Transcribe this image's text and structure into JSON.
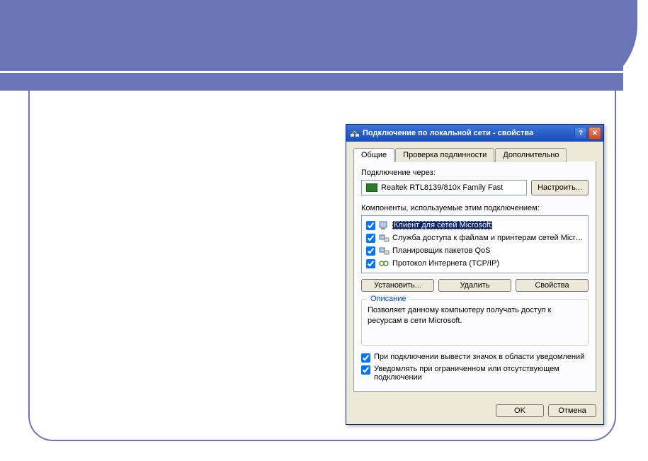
{
  "window": {
    "title": "Подключение по локальной сети - свойства",
    "help_label": "?",
    "close_label": "✕"
  },
  "tabs": [
    {
      "label": "Общие",
      "active": true
    },
    {
      "label": "Проверка подлинности",
      "active": false
    },
    {
      "label": "Дополнительно",
      "active": false
    }
  ],
  "connect_via": {
    "label": "Подключение через:",
    "adapter": "Realtek RTL8139/810x Family Fast",
    "configure_btn": "Настроить..."
  },
  "components": {
    "label": "Компоненты, используемые этим подключением:",
    "items": [
      {
        "checked": true,
        "icon": "client-icon",
        "label": "Клиент для сетей Microsoft",
        "selected": true
      },
      {
        "checked": true,
        "icon": "service-icon",
        "label": "Служба доступа к файлам и принтерам сетей Micro..."
      },
      {
        "checked": true,
        "icon": "service-icon",
        "label": "Планировщик пакетов QoS"
      },
      {
        "checked": true,
        "icon": "protocol-icon",
        "label": "Протокол Интернета (TCP/IP)"
      }
    ],
    "install_btn": "Установить...",
    "remove_btn": "Удалить",
    "properties_btn": "Свойства"
  },
  "description": {
    "legend": "Описание",
    "text": "Позволяет данному компьютеру получать доступ к ресурсам в сети Microsoft."
  },
  "options": {
    "show_icon": {
      "checked": true,
      "label": "При подключении вывести значок в области уведомлений"
    },
    "notify_limited": {
      "checked": true,
      "label": "Уведомлять при ограниченном или отсутствующем подключении"
    }
  },
  "footer": {
    "ok": "OK",
    "cancel": "Отмена"
  }
}
